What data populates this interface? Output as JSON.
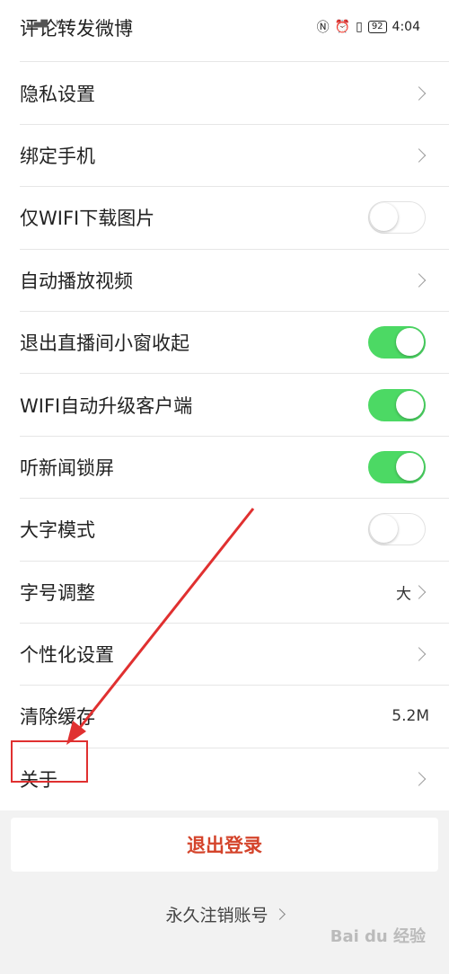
{
  "status_bar": {
    "speed": "K/s",
    "battery": "92",
    "time": "4:04"
  },
  "settings": {
    "rows": [
      {
        "label": "评论转发微博",
        "control": "none"
      },
      {
        "label": "隐私设置",
        "control": "chevron"
      },
      {
        "label": "绑定手机",
        "control": "chevron"
      },
      {
        "label": "仅WIFI下载图片",
        "control": "toggle",
        "on": false
      },
      {
        "label": "自动播放视频",
        "control": "chevron"
      },
      {
        "label": "退出直播间小窗收起",
        "control": "toggle",
        "on": true
      },
      {
        "label": "WIFI自动升级客户端",
        "control": "toggle",
        "on": true
      },
      {
        "label": "听新闻锁屏",
        "control": "toggle",
        "on": true
      },
      {
        "label": "大字模式",
        "control": "toggle",
        "on": false
      },
      {
        "label": "字号调整",
        "control": "value-chevron",
        "value": "大"
      },
      {
        "label": "个性化设置",
        "control": "chevron"
      },
      {
        "label": "清除缓存",
        "control": "value",
        "value": "5.2M"
      },
      {
        "label": "关于",
        "control": "chevron"
      }
    ]
  },
  "logout_label": "退出登录",
  "cancel_account_label": "永久注销账号",
  "watermark": "Bai du 经验",
  "colors": {
    "toggle_on": "#4cd964",
    "logout_text": "#d4442b",
    "annotation": "#e03030"
  }
}
